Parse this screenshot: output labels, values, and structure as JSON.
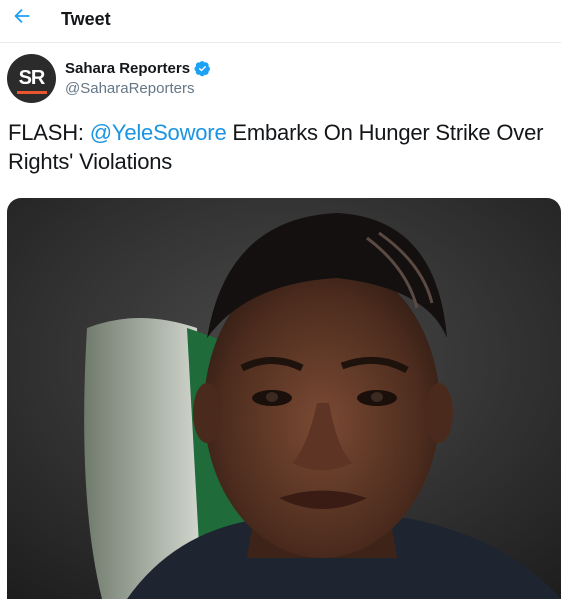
{
  "header": {
    "back_icon": "arrow-left-icon",
    "title": "Tweet"
  },
  "tweet": {
    "avatar_text": "SR",
    "display_name": "Sahara Reporters",
    "verified_icon": "verified-badge-icon",
    "handle": "@SaharaReporters",
    "text_prefix": "FLASH: ",
    "mention": "@YeleSowore",
    "text_suffix": " Embarks On Hunger Strike Over Rights' Violations",
    "media_alt_icon": "photo-of-man-icon"
  },
  "colors": {
    "accent": "#1b95e0",
    "text": "#14171a",
    "muted": "#657786",
    "verified": "#1da1f2",
    "avatar_bg": "#2b2b2b",
    "avatar_bar": "#e8552f"
  }
}
